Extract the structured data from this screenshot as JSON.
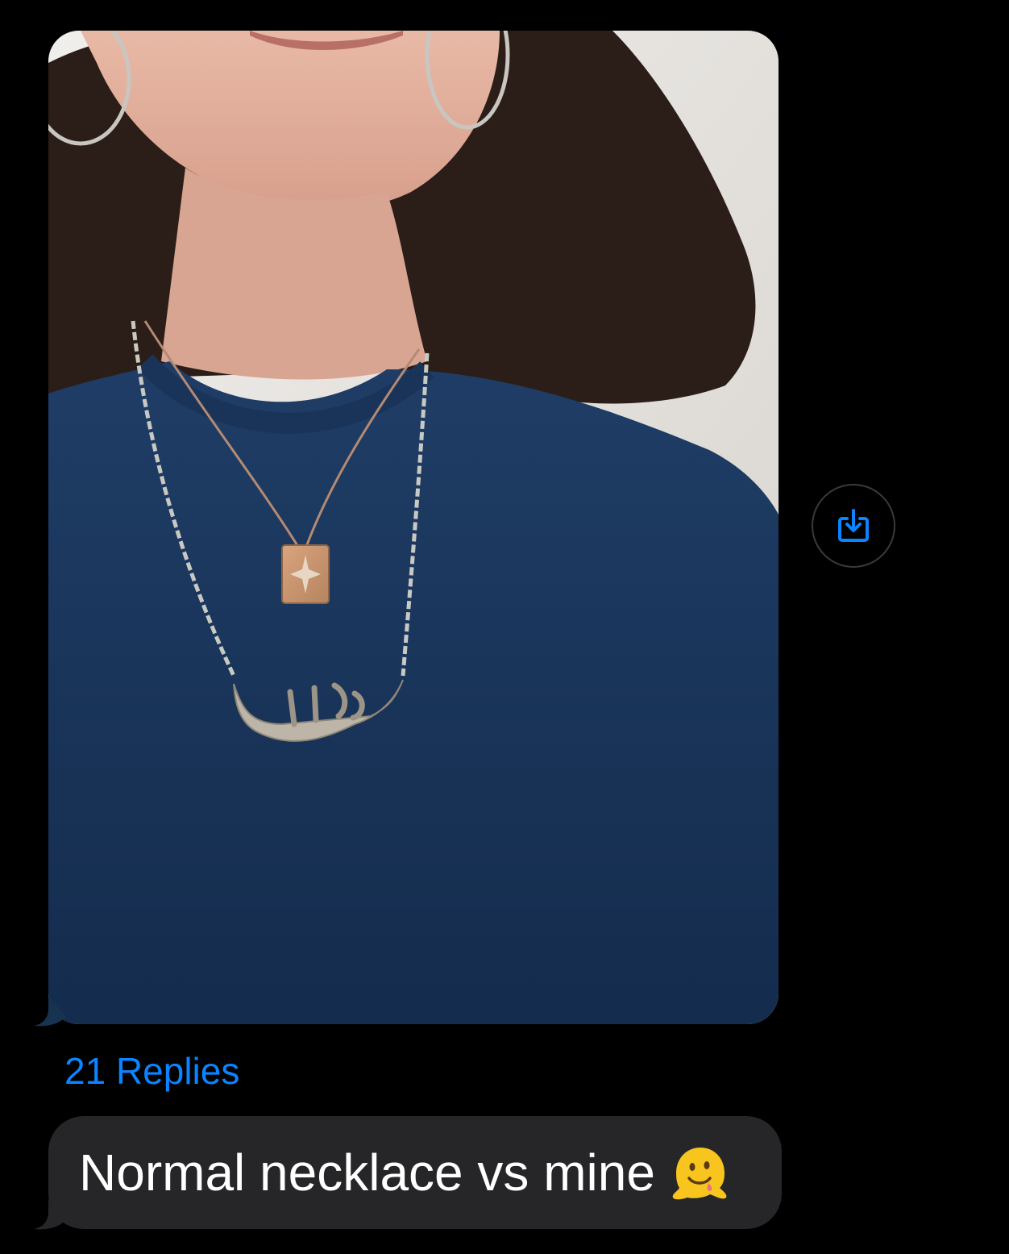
{
  "thread": {
    "photo_message": {
      "image_description_icon": "photo-icon",
      "save_action_icon": "save-to-photos-icon"
    },
    "replies": {
      "label": "21 Replies"
    },
    "text_message": {
      "text": "Normal necklace vs mine",
      "emoji_icon": "melting-face-emoji"
    }
  },
  "colors": {
    "background": "#000000",
    "link_blue": "#0a84ff",
    "incoming_bubble": "#262628",
    "message_text": "#ffffff"
  }
}
